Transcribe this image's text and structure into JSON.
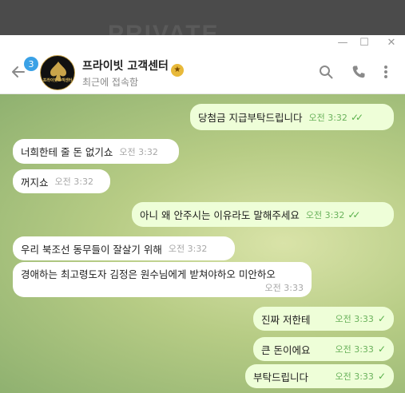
{
  "background": {
    "word": "PRIVATE"
  },
  "window_controls": {
    "minimize": "—",
    "maximize": "☐",
    "close": "✕"
  },
  "header": {
    "unread_count": "3",
    "avatar_text": "프라이빗고객센터",
    "contact_name": "프라이빗 고객센터",
    "verified_mark": "★",
    "status": "최근에 접속함"
  },
  "icons": {
    "back": "back-arrow-icon",
    "search": "search-icon",
    "call": "phone-icon",
    "more": "more-vertical-icon"
  },
  "colors": {
    "accent": "#3aa1e6",
    "outgoing_bubble": "#eefed8",
    "incoming_bubble": "#ffffff",
    "check": "#58b04a"
  },
  "messages": [
    {
      "dir": "out",
      "text": "당첨금 지급부탁드립니다",
      "time": "오전 3:32",
      "status": "read"
    },
    {
      "dir": "in",
      "text": "너희한테 줄 돈 없기쇼",
      "time": "오전 3:32"
    },
    {
      "dir": "in",
      "text": "꺼지쇼",
      "time": "오전 3:32"
    },
    {
      "dir": "out",
      "text": "아니 왜 안주시는 이유라도 말해주세요",
      "time": "오전 3:32",
      "status": "read"
    },
    {
      "dir": "in",
      "text": "우리 북조선 동무들이 잘살기 위해",
      "time": "오전 3:32"
    },
    {
      "dir": "in",
      "text": "경애하는 최고령도자 김정은 원수님에게 받쳐야하오 미안하오",
      "time": "오전 3:33"
    },
    {
      "dir": "out",
      "text": "진짜 저한테",
      "time": "오전 3:33",
      "status": "sent"
    },
    {
      "dir": "out",
      "text": "큰 돈이에요",
      "time": "오전 3:33",
      "status": "sent"
    },
    {
      "dir": "out",
      "text": "부탁드립니다",
      "time": "오전 3:33",
      "status": "sent"
    }
  ]
}
